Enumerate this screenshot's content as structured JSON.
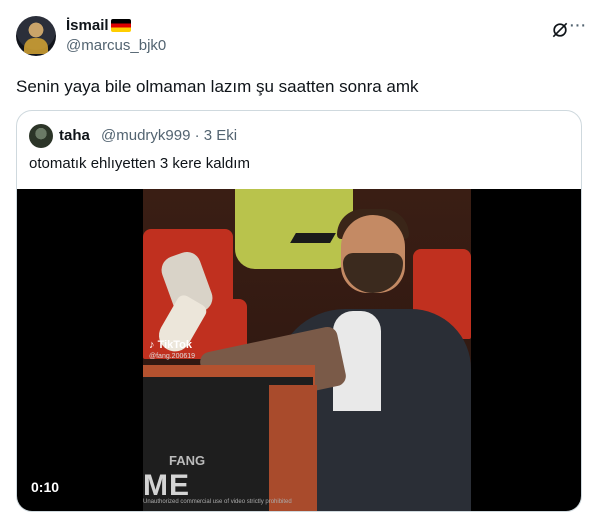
{
  "tweet": {
    "display_name": "İsmail",
    "handle": "@marcus_bjk0",
    "text": "Senin yaya bile olmaman lazım şu saatten sonra amk"
  },
  "quote": {
    "display_name": "taha",
    "handle": "@mudryk999",
    "separator": "·",
    "date": "3 Eki",
    "text": "otomatık ehlıyetten 3 kere kaldım"
  },
  "media": {
    "timecode": "0:10",
    "watermark_brand": "TikTok",
    "watermark_user": "@fang.200619",
    "overlay_big": "ME",
    "overlay_small": "FANG",
    "disclaimer": "Unauthorized commercial use of video strictly prohibited"
  },
  "icons": {
    "flag": "germany-flag-icon",
    "grok": "grok-icon",
    "more": "more-icon",
    "tiktok": "tiktok-icon"
  }
}
